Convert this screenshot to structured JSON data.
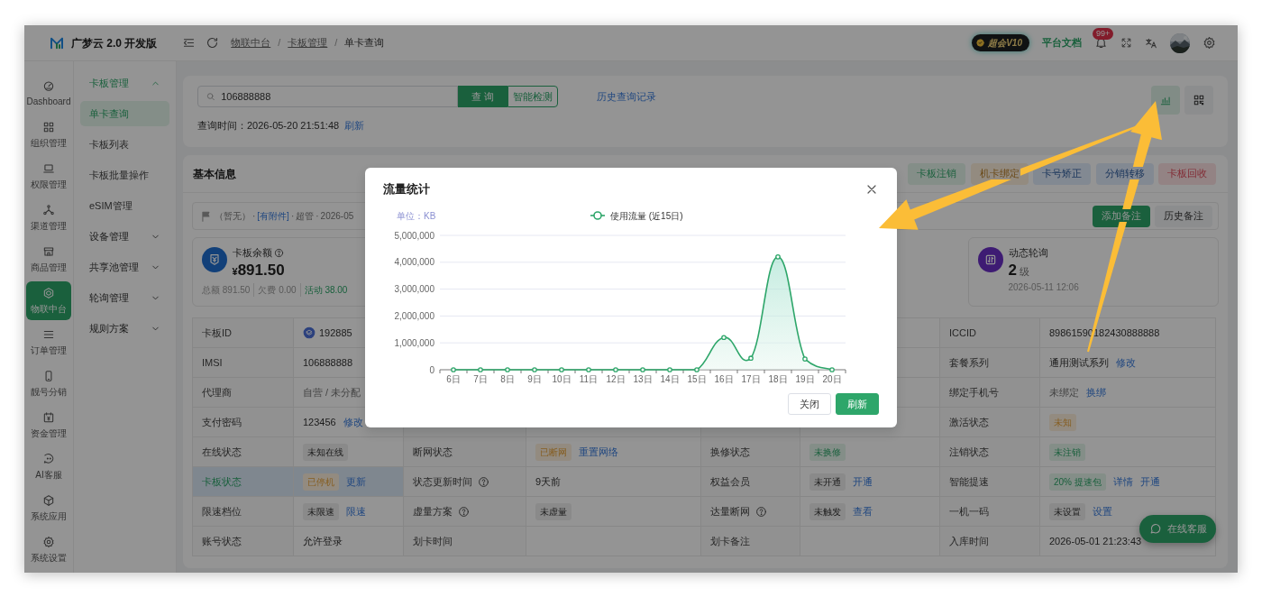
{
  "app": {
    "title": "广梦云 2.0 开发版"
  },
  "header": {
    "breadcrumb": [
      {
        "text": "物联中台",
        "kind": "link"
      },
      {
        "text": "/",
        "kind": "sep"
      },
      {
        "text": "卡板管理",
        "kind": "link"
      },
      {
        "text": "/",
        "kind": "sep"
      },
      {
        "text": "单卡查询",
        "kind": "current"
      }
    ],
    "vip_badge": "超会V10",
    "docs_link": "平台文档",
    "notification_count": "99+"
  },
  "rail": [
    {
      "label": "Dashboard",
      "selected": false
    },
    {
      "label": "组织管理",
      "selected": false
    },
    {
      "label": "权限管理",
      "selected": false
    },
    {
      "label": "渠道管理",
      "selected": false
    },
    {
      "label": "商品管理",
      "selected": false
    },
    {
      "label": "物联中台",
      "selected": true
    },
    {
      "label": "订单管理",
      "selected": false
    },
    {
      "label": "靓号分销",
      "selected": false
    },
    {
      "label": "资金管理",
      "selected": false
    },
    {
      "label": "AI客服",
      "selected": false
    },
    {
      "label": "系统应用",
      "selected": false
    },
    {
      "label": "系统设置",
      "selected": false
    }
  ],
  "submenu": [
    {
      "label": "卡板管理",
      "expanded": true,
      "children": [
        {
          "label": "单卡查询",
          "selected": true
        },
        {
          "label": "卡板列表",
          "selected": false
        },
        {
          "label": "卡板批量操作",
          "selected": false
        },
        {
          "label": "eSIM管理",
          "selected": false
        }
      ]
    },
    {
      "label": "设备管理",
      "expanded": false
    },
    {
      "label": "共享池管理",
      "expanded": false
    },
    {
      "label": "轮询管理",
      "expanded": false
    },
    {
      "label": "规则方案",
      "expanded": false
    }
  ],
  "search": {
    "value": "106888888",
    "query_button": "查 询",
    "detect_button": "智能检测",
    "history_link": "历史查询记录",
    "query_time": "查询时间：2026-05-20 21:51:48",
    "refresh_link": "刷新",
    "tools": [
      {
        "kind": "chart",
        "selected": true
      },
      {
        "kind": "qr",
        "selected": false
      }
    ]
  },
  "basic_info": {
    "title": "基本信息",
    "actions": [
      {
        "label": "卡板注销",
        "kind": "success"
      },
      {
        "label": "机卡绑定",
        "kind": "warning"
      },
      {
        "label": "卡号矫正",
        "kind": "info"
      },
      {
        "label": "分销转移",
        "kind": "info"
      },
      {
        "label": "卡板回收",
        "kind": "danger"
      }
    ]
  },
  "remark": {
    "parts": [
      {
        "text": "（暂无）",
        "kind": "text"
      },
      {
        "text": "·",
        "kind": "sep"
      },
      {
        "text": "[有附件]",
        "kind": "link"
      },
      {
        "text": "·",
        "kind": "sep"
      },
      {
        "text": "超管",
        "kind": "text"
      },
      {
        "text": "·",
        "kind": "sep"
      },
      {
        "text": "2026-05",
        "kind": "text"
      }
    ],
    "buttons": [
      {
        "label": "添加备注",
        "kind": "primary"
      },
      {
        "label": "历史备注",
        "kind": "secondary"
      }
    ]
  },
  "stat_cards": [
    {
      "kind": "balance",
      "title": "卡板余额",
      "help": true,
      "currency": "¥",
      "value": "891.50",
      "details": [
        {
          "text": "总额 891.50",
          "kind": "muted"
        },
        {
          "text": "欠费 0.00",
          "kind": "muted"
        },
        {
          "text": "活动 38.00",
          "kind": "success"
        }
      ]
    },
    {
      "kind": "polling",
      "title": "动态轮询",
      "help": false,
      "value": "2",
      "unit": "级",
      "date": "2026-05-11 12:06"
    }
  ],
  "table": {
    "rows": [
      {
        "highlighted": false,
        "col_1": {
          "label": "卡板ID",
          "help": false,
          "value": [
            {
              "kind": "carrier",
              "text": "192885"
            }
          ]
        },
        "col_4": {
          "label": "ICCID",
          "help": false,
          "value": [
            {
              "kind": "text",
              "text": "89861590182430888888"
            }
          ]
        }
      },
      {
        "highlighted": false,
        "col_1": {
          "label": "IMSI",
          "help": false,
          "value": [
            {
              "kind": "text",
              "text": "106888888"
            }
          ]
        },
        "col_4": {
          "label": "套餐系列",
          "help": false,
          "value": [
            {
              "kind": "text",
              "text": "通用测试系列"
            },
            {
              "kind": "link",
              "text": "修改"
            }
          ]
        }
      },
      {
        "highlighted": false,
        "col_1": {
          "label": "代理商",
          "help": false,
          "value": [
            {
              "kind": "muted",
              "text": "自营 / 未分配"
            }
          ]
        },
        "col_4": {
          "label": "绑定手机号",
          "help": false,
          "value": [
            {
              "kind": "muted",
              "text": "未绑定"
            },
            {
              "kind": "link",
              "text": "换绑"
            }
          ]
        }
      },
      {
        "highlighted": false,
        "col_1": {
          "label": "支付密码",
          "help": false,
          "value": [
            {
              "kind": "text",
              "text": "123456"
            },
            {
              "kind": "link",
              "text": "修改"
            }
          ]
        },
        "col_4": {
          "label": "激活状态",
          "help": false,
          "value": [
            {
              "kind": "warning-tag",
              "text": "未知"
            }
          ]
        }
      },
      {
        "highlighted": false,
        "col_1": {
          "label": "在线状态",
          "help": false,
          "value": [
            {
              "kind": "neutral-tag",
              "text": "未知在线"
            }
          ]
        },
        "col_2": {
          "label": "断网状态",
          "help": false,
          "value": [
            {
              "kind": "warning-tag",
              "text": "已断网"
            },
            {
              "kind": "link",
              "text": "重置网络"
            }
          ]
        },
        "col_3": {
          "label": "换修状态",
          "help": false,
          "value": [
            {
              "kind": "success-tag",
              "text": "未换修"
            }
          ]
        },
        "col_4": {
          "label": "注销状态",
          "help": false,
          "value": [
            {
              "kind": "success-tag",
              "text": "未注销"
            }
          ]
        }
      },
      {
        "highlighted": true,
        "col_1": {
          "label": "卡板状态",
          "help": false,
          "value": [
            {
              "kind": "warning-tag",
              "text": "已停机"
            },
            {
              "kind": "link",
              "text": "更新"
            }
          ]
        },
        "col_2": {
          "label": "状态更新时间",
          "help": true,
          "value": [
            {
              "kind": "text",
              "text": "9天前"
            }
          ]
        },
        "col_3": {
          "label": "权益会员",
          "help": false,
          "value": [
            {
              "kind": "neutral-tag",
              "text": "未开通"
            },
            {
              "kind": "link",
              "text": "开通"
            }
          ]
        },
        "col_4": {
          "label": "智能提速",
          "help": false,
          "value": [
            {
              "kind": "success-tag",
              "text": "20% 提速包"
            },
            {
              "kind": "link",
              "text": "详情"
            },
            {
              "kind": "link",
              "text": "开通"
            }
          ]
        }
      },
      {
        "highlighted": false,
        "col_1": {
          "label": "限速档位",
          "help": false,
          "value": [
            {
              "kind": "neutral-tag",
              "text": "未限速"
            },
            {
              "kind": "link",
              "text": "限速"
            }
          ]
        },
        "col_2": {
          "label": "虚量方案",
          "help": true,
          "value": [
            {
              "kind": "neutral-tag",
              "text": "未虚量"
            }
          ]
        },
        "col_3": {
          "label": "达量断网",
          "help": true,
          "value": [
            {
              "kind": "neutral-tag",
              "text": "未触发"
            },
            {
              "kind": "link",
              "text": "查看"
            }
          ]
        },
        "col_4": {
          "label": "一机一码",
          "help": false,
          "value": [
            {
              "kind": "neutral-tag",
              "text": "未设置"
            },
            {
              "kind": "link",
              "text": "设置"
            }
          ]
        }
      },
      {
        "highlighted": false,
        "col_1": {
          "label": "账号状态",
          "help": false,
          "value": [
            {
              "kind": "text",
              "text": "允许登录"
            }
          ]
        },
        "col_2": {
          "label": "划卡时间",
          "help": false
        },
        "col_3": {
          "label": "划卡备注",
          "help": false
        },
        "col_4": {
          "label": "入库时间",
          "help": false,
          "value": [
            {
              "kind": "text",
              "text": "2026-05-01 21:23:43"
            }
          ]
        }
      }
    ]
  },
  "support_button": "在线客服",
  "modal": {
    "title": "流量统计",
    "unit_label": "单位：KB",
    "chart_data": {
      "type": "area",
      "grid": true,
      "categories": [
        "6日",
        "7日",
        "8日",
        "9日",
        "10日",
        "11日",
        "12日",
        "13日",
        "14日",
        "15日",
        "16日",
        "17日",
        "18日",
        "19日",
        "20日"
      ],
      "series": [
        {
          "name": "使用流量 (近15日)",
          "color": "#2ea66a",
          "values": [
            0,
            0,
            0,
            0,
            0,
            0,
            0,
            0,
            0,
            0,
            1200000,
            430000,
            4200000,
            400000,
            0
          ]
        }
      ],
      "ylim": [
        0,
        5000000
      ],
      "yticks": [
        {
          "value": 0,
          "label": "0"
        },
        {
          "value": 1000000,
          "label": "1,000,000"
        },
        {
          "value": 2000000,
          "label": "2,000,000"
        },
        {
          "value": 3000000,
          "label": "3,000,000"
        },
        {
          "value": 4000000,
          "label": "4,000,000"
        },
        {
          "value": 5000000,
          "label": "5,000,000"
        }
      ]
    },
    "buttons": [
      {
        "label": "关闭",
        "kind": "secondary"
      },
      {
        "label": "刷新",
        "kind": "primary"
      }
    ]
  }
}
